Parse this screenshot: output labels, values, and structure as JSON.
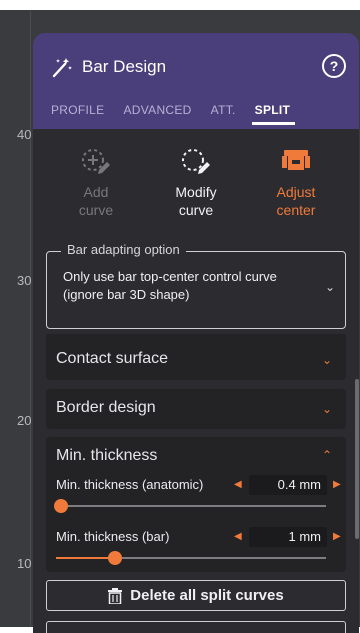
{
  "viewport": {
    "axis_ticks": [
      "40",
      "30",
      "20",
      "10"
    ]
  },
  "header": {
    "title": "Bar Design",
    "help_glyph": "?",
    "tabs": [
      {
        "label": "PROFILE",
        "active": false
      },
      {
        "label": "ADVANCED",
        "active": false
      },
      {
        "label": "ATT.",
        "active": false
      },
      {
        "label": "SPLIT",
        "active": true
      }
    ]
  },
  "tools": [
    {
      "line1": "Add",
      "line2": "curve",
      "state": "disabled",
      "icon": "add-curve-icon"
    },
    {
      "line1": "Modify",
      "line2": "curve",
      "state": "normal",
      "icon": "modify-curve-icon"
    },
    {
      "line1": "Adjust",
      "line2": "center",
      "state": "active",
      "icon": "adjust-center-icon"
    }
  ],
  "bar_adapting": {
    "legend": "Bar adapting option",
    "value_line1": "Only use bar top-center control curve",
    "value_line2": "(ignore bar 3D shape)"
  },
  "sections": {
    "contact_surface": "Contact surface",
    "border_design": "Border design",
    "min_thickness": "Min. thickness"
  },
  "sliders": [
    {
      "label": "Min. thickness (anatomic)",
      "value": "0.4 mm",
      "fraction": 0.0
    },
    {
      "label": "Min. thickness (bar)",
      "value": "1 mm",
      "fraction": 0.2
    }
  ],
  "actions": {
    "delete_all": "Delete all split curves"
  },
  "colors": {
    "header": "#4a3f7a",
    "accent": "#f07a3a",
    "panel": "#2c2c30"
  }
}
